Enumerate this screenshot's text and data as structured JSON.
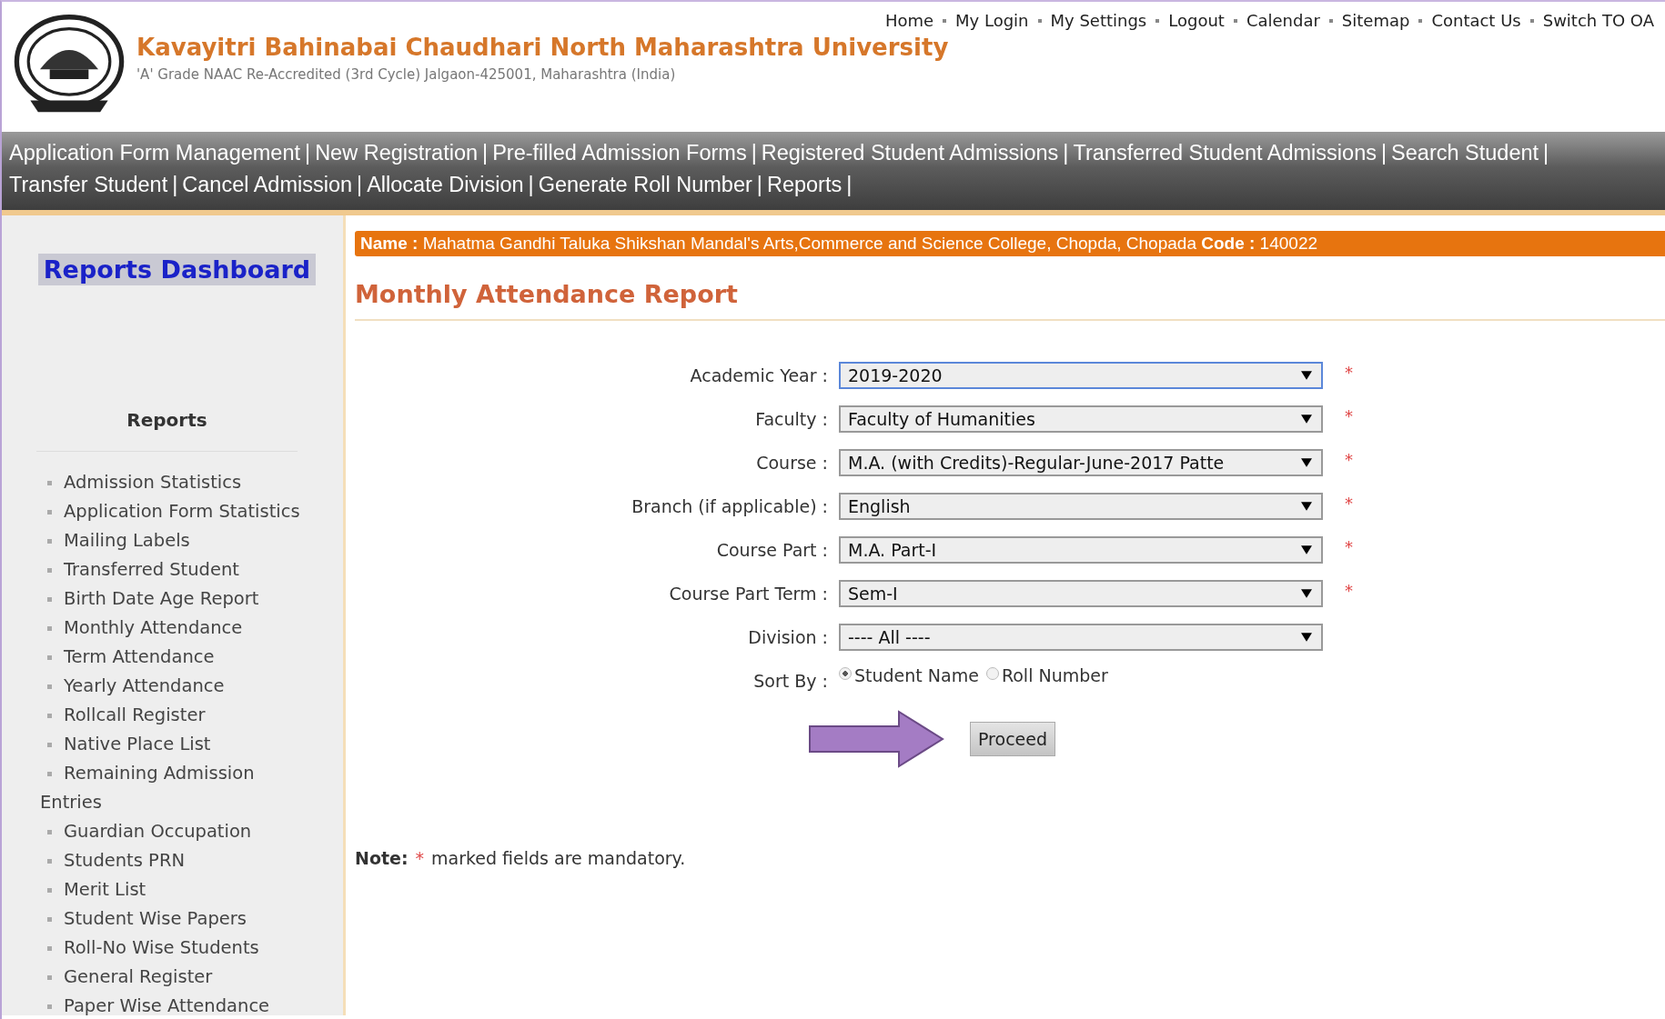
{
  "header": {
    "top_links": [
      "Home",
      "My Login",
      "My Settings",
      "Logout",
      "Calendar",
      "Sitemap",
      "Contact Us",
      "Switch TO OA"
    ],
    "title": "Kavayitri Bahinabai Chaudhari North Maharashtra University",
    "subtitle": "'A' Grade NAAC Re-Accredited (3rd Cycle) Jalgaon-425001, Maharashtra (India)"
  },
  "nav": {
    "separator": "|",
    "items": [
      "Application Form Management",
      "New Registration",
      "Pre-filled Admission Forms",
      "Registered Student Admissions",
      "Transferred Student Admissions",
      "Search Student",
      "Transfer Student",
      "Cancel Admission",
      "Allocate Division",
      "Generate Roll Number",
      "Reports"
    ]
  },
  "sidebar": {
    "dashboard_link": "Reports Dashboard",
    "heading": "Reports",
    "items": [
      {
        "label": "Admission Statistics",
        "selected": false
      },
      {
        "label": "Application Form Statistics",
        "selected": false
      },
      {
        "label": "Mailing Labels",
        "selected": false
      },
      {
        "label": "Transferred Student",
        "selected": false
      },
      {
        "label": "Birth Date Age Report",
        "selected": false
      },
      {
        "label": "Monthly Attendance",
        "selected": false
      },
      {
        "label": "Term Attendance",
        "selected": false
      },
      {
        "label": "Yearly Attendance",
        "selected": false
      },
      {
        "label": "Rollcall Register",
        "selected": false
      },
      {
        "label": "Native Place List",
        "selected": false
      },
      {
        "label": "Remaining Admission Entries",
        "selected": false
      },
      {
        "label": "Guardian Occupation",
        "selected": false
      },
      {
        "label": "Students PRN",
        "selected": false
      },
      {
        "label": "Merit List",
        "selected": false
      },
      {
        "label": "Student Wise Papers",
        "selected": false
      },
      {
        "label": "Roll-No Wise Students",
        "selected": false
      },
      {
        "label": "General Register",
        "selected": false
      },
      {
        "label": "Paper Wise Attendance",
        "selected": false
      }
    ]
  },
  "college_bar": "**Name :** Mahatma Gandhi Taluka Shikshan Mandal's Arts,Commerce and Science College, Chopda, Chopada **Code :** 140022",
  "page_title": "Monthly Attendance Report",
  "form": {
    "required_mark": "*",
    "fields": [
      {
        "kind": "select",
        "label": "Academic Year :",
        "value": "2019-2020",
        "required": true,
        "focused": true
      },
      {
        "kind": "select",
        "label": "Faculty :",
        "value": "Faculty of Humanities",
        "required": true,
        "focused": false
      },
      {
        "kind": "select",
        "label": "Course :",
        "value": "M.A. (with Credits)-Regular-June-2017 Patte",
        "required": true,
        "focused": false
      },
      {
        "kind": "select",
        "label": "Branch (if applicable) :",
        "value": "English",
        "required": true,
        "focused": false
      },
      {
        "kind": "select",
        "label": "Course Part :",
        "value": "M.A. Part-I",
        "required": true,
        "focused": false
      },
      {
        "kind": "select",
        "label": "Course Part Term :",
        "value": "Sem-I",
        "required": true,
        "focused": false
      },
      {
        "kind": "select",
        "label": "Division :",
        "value": "---- All ----",
        "required": false,
        "focused": false
      },
      {
        "kind": "radio",
        "label": "Sort By :",
        "options": [
          {
            "label": "Student Name",
            "selected": true
          },
          {
            "label": "Roll Number",
            "selected": false
          }
        ],
        "required": false
      }
    ],
    "submit": "Proceed"
  },
  "note": {
    "label": "Note:",
    "mark": "*",
    "text": "marked fields are mandatory."
  }
}
